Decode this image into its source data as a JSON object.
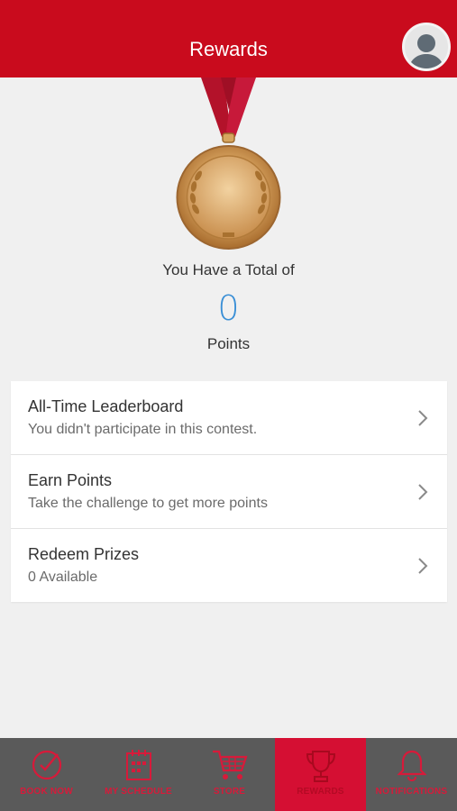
{
  "header": {
    "title": "Rewards"
  },
  "summary": {
    "total_label": "You Have a Total of",
    "points_value": "0",
    "points_label": "Points"
  },
  "menu": [
    {
      "title": "All-Time Leaderboard",
      "subtitle": "You didn't participate in this contest."
    },
    {
      "title": "Earn Points",
      "subtitle": "Take the challenge to get more points"
    },
    {
      "title": "Redeem Prizes",
      "subtitle": "0 Available"
    }
  ],
  "tabbar": {
    "tabs": [
      {
        "label": "BOOK NOW",
        "icon": "check-circle-icon"
      },
      {
        "label": "MY SCHEDULE",
        "icon": "calendar-icon"
      },
      {
        "label": "STORE",
        "icon": "cart-icon"
      },
      {
        "label": "REWARDS",
        "icon": "trophy-icon",
        "active": true
      },
      {
        "label": "NOTIFICATIONS",
        "icon": "bell-icon"
      }
    ]
  },
  "colors": {
    "brand_red": "#c90b1d",
    "active_tab": "#d50f33",
    "tabbar_bg": "#5a5a5a",
    "points_blue": "#3a8fd6"
  }
}
